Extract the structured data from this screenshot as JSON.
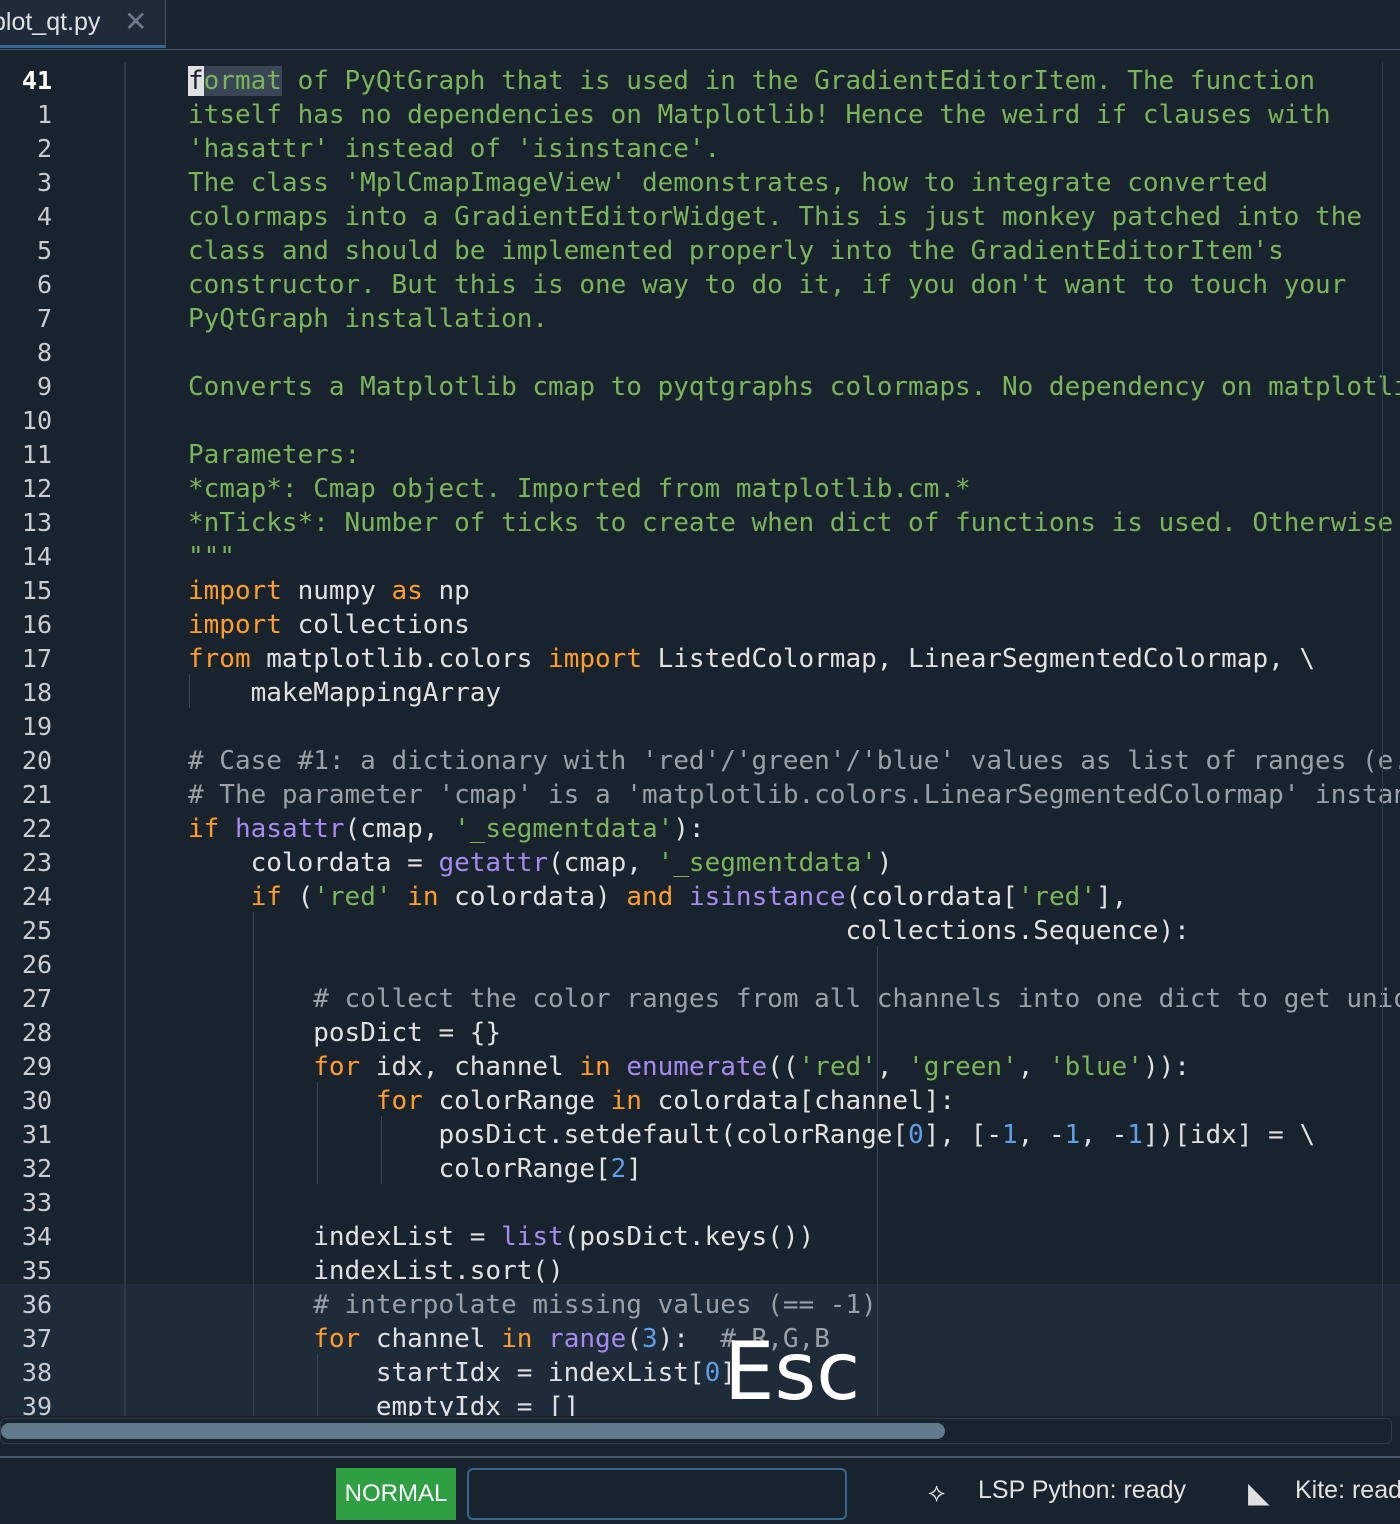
{
  "tab": {
    "label": "plot_qt.py",
    "close_icon": "close-icon"
  },
  "editor": {
    "line_numbers": [
      "41",
      "1",
      "2",
      "3",
      "4",
      "5",
      "6",
      "7",
      "8",
      "9",
      "10",
      "11",
      "12",
      "13",
      "14",
      "15",
      "16",
      "17",
      "18",
      "19",
      "20",
      "21",
      "22",
      "23",
      "24",
      "25",
      "26",
      "27",
      "28",
      "29",
      "30",
      "31",
      "32",
      "33",
      "34",
      "35",
      "36",
      "37",
      "38",
      "39"
    ],
    "current_line": "41",
    "overlay_key": "Esc"
  },
  "statusbar": {
    "mode": "NORMAL",
    "vim_command": "",
    "lsp_label": "LSP Python: ready",
    "kite_label": "Kite: ready",
    "lsp_icon": "lsp-icon",
    "kite_icon": "kite-icon",
    "mode_color": "#2ea043"
  },
  "colors": {
    "background": "#19232d",
    "docstring": "#7cb45b",
    "keyword": "#ff9d2b",
    "builtin": "#a38cf0",
    "comment": "#9aa0a6",
    "number": "#5f9ee8"
  }
}
